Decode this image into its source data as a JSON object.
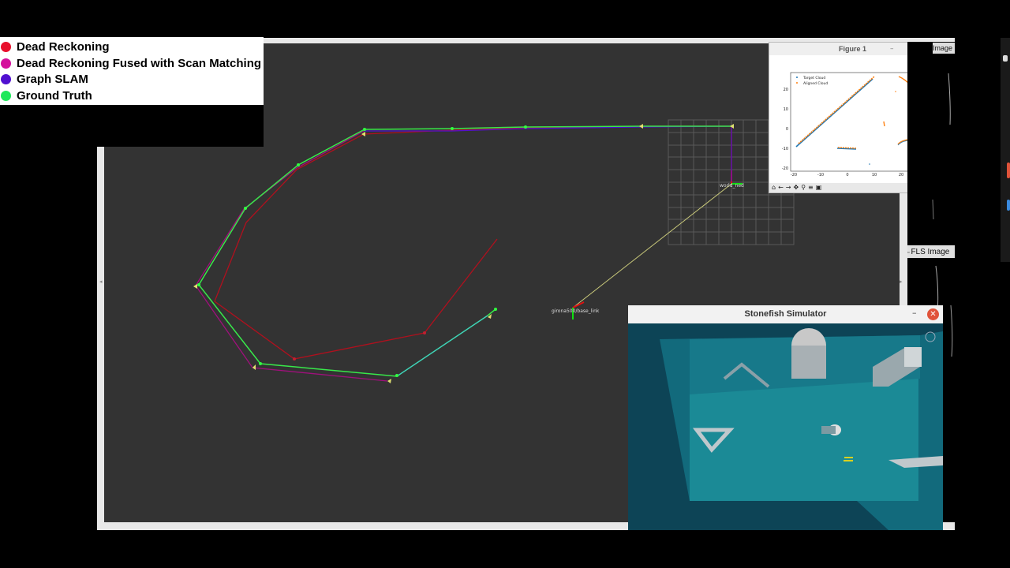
{
  "legend": {
    "items": [
      {
        "label": "Dead Reckoning",
        "color": "#e8102c"
      },
      {
        "label": "Dead Reckoning Fused with Scan Matching",
        "color": "#d4109c"
      },
      {
        "label": "Graph SLAM",
        "color": "#5010d0"
      },
      {
        "label": "Ground Truth",
        "color": "#1ee85a"
      }
    ]
  },
  "rviz": {
    "frame_world": "world_ned",
    "frame_robot": "girona500/base_link"
  },
  "figure": {
    "window_title": "Figure 1",
    "legend_target": "Target Cloud",
    "legend_aligned": "Aligned Cloud",
    "y_ticks": [
      "20",
      "10",
      "0",
      "-10",
      "-20"
    ],
    "x_ticks": [
      "-20",
      "-10",
      "0",
      "10",
      "20"
    ],
    "colors": {
      "target": "#1f77b4",
      "aligned": "#ff7f0e"
    }
  },
  "panels": {
    "top_image_tab": "Image",
    "fls_image_tab": "FLS Image"
  },
  "simulator": {
    "window_title": "Stonefish Simulator"
  },
  "icons": [
    "home-icon",
    "back-arrow-icon",
    "forward-arrow-icon",
    "pan-icon",
    "zoom-icon",
    "configure-icon",
    "save-icon",
    "close-icon",
    "minimize-icon",
    "maximize-icon"
  ]
}
